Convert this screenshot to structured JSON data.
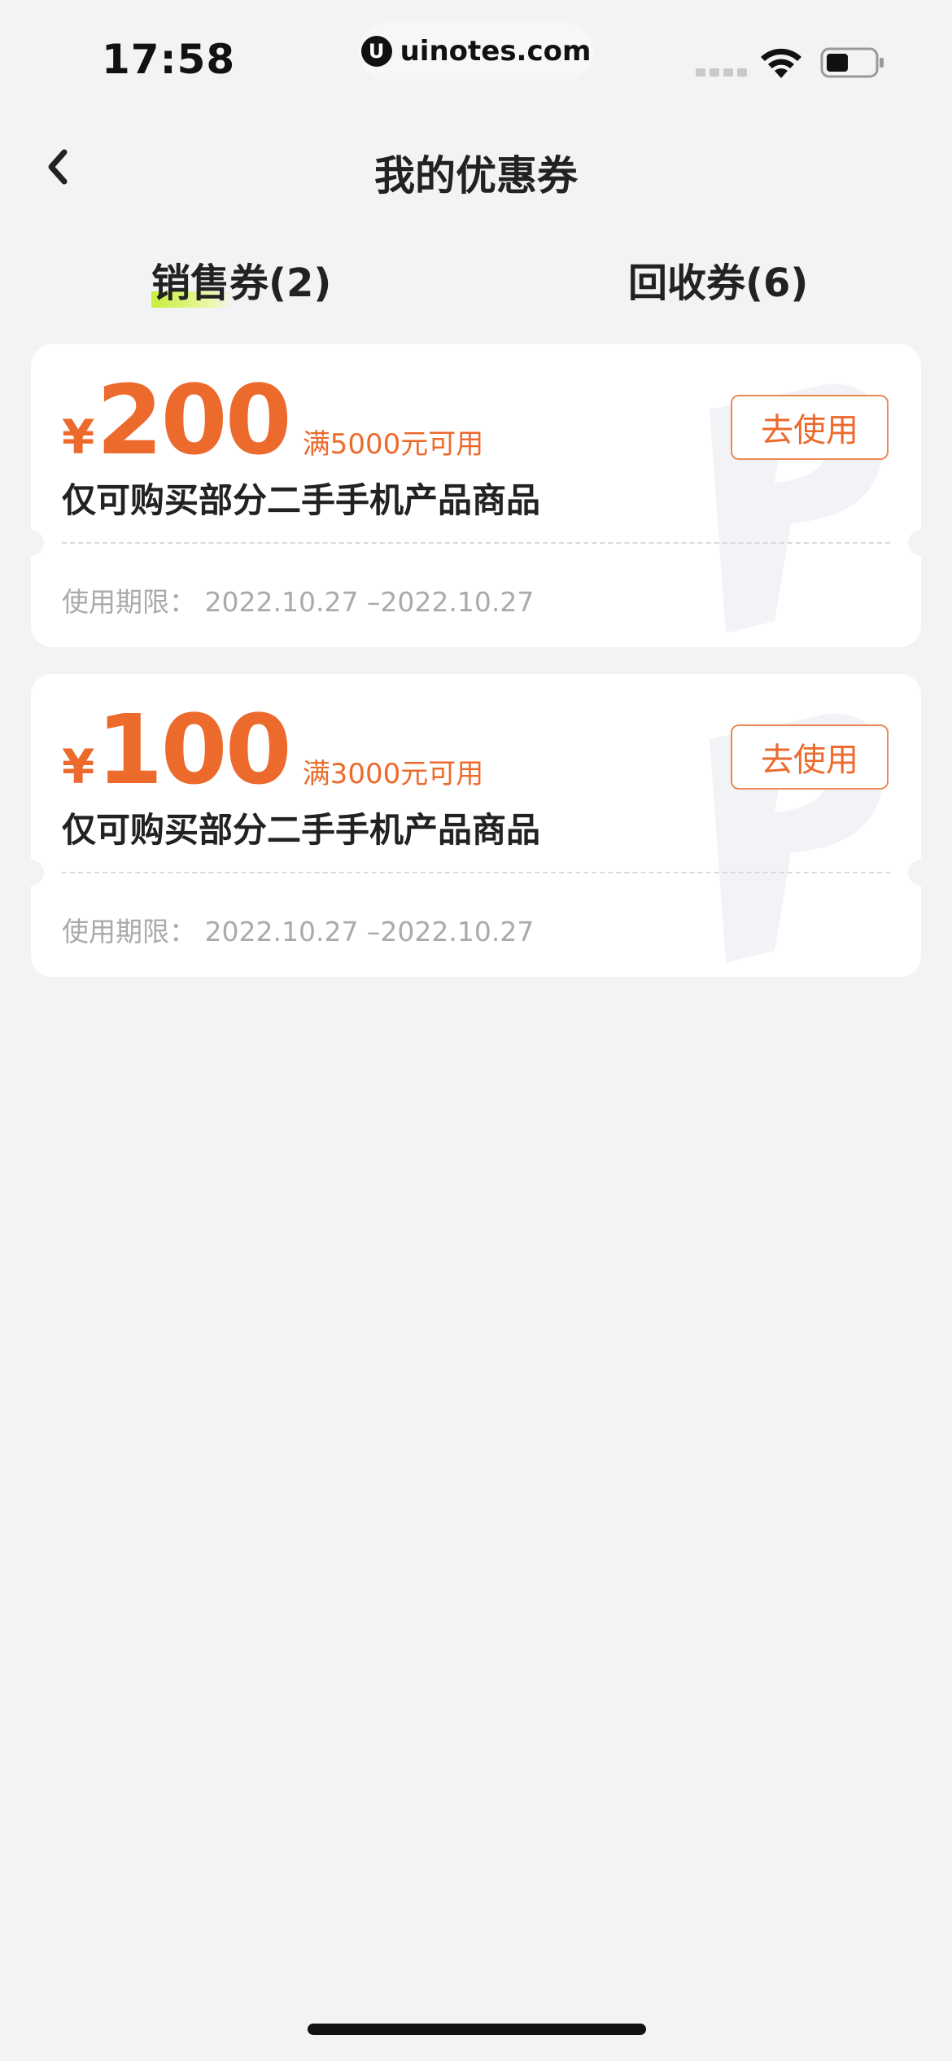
{
  "status_bar": {
    "time": "17:58",
    "url": "uinotes.com",
    "url_logo": "U"
  },
  "nav": {
    "title": "我的优惠券",
    "back_icon": "chevron-left-icon"
  },
  "tabs": [
    {
      "label": "销售券(2)",
      "active": true
    },
    {
      "label": "回收券(6)",
      "active": false
    }
  ],
  "coupons": [
    {
      "currency": "¥",
      "amount": "200",
      "condition": "满5000元可用",
      "description": "仅可购买部分二手手机产品商品",
      "validity": "使用期限：  2022.10.27 –2022.10.27",
      "button": "去使用"
    },
    {
      "currency": "¥",
      "amount": "100",
      "condition": "满3000元可用",
      "description": "仅可购买部分二手手机产品商品",
      "validity": "使用期限：  2022.10.27 –2022.10.27",
      "button": "去使用"
    }
  ],
  "colors": {
    "accent": "#ec6a2c",
    "background": "#f2f3f5",
    "tab_highlight": "#c6ef3a"
  }
}
